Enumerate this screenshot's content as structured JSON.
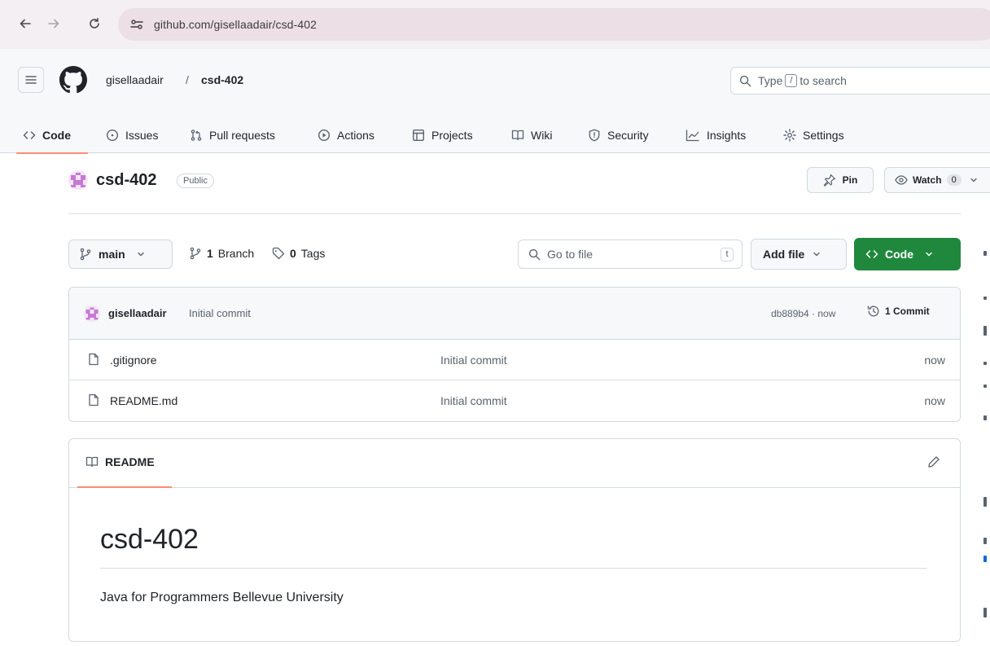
{
  "browser": {
    "url": "github.com/gisellaadair/csd-402"
  },
  "header": {
    "owner": "gisellaadair",
    "separator": "/",
    "repo": "csd-402",
    "search_prefix": "Type",
    "search_key": "/",
    "search_suffix": "to search"
  },
  "tabs": [
    {
      "label": "Code",
      "icon": "code-icon",
      "selected": true
    },
    {
      "label": "Issues",
      "icon": "issue-icon"
    },
    {
      "label": "Pull requests",
      "icon": "pull-request-icon"
    },
    {
      "label": "Actions",
      "icon": "play-icon"
    },
    {
      "label": "Projects",
      "icon": "table-icon"
    },
    {
      "label": "Wiki",
      "icon": "book-icon"
    },
    {
      "label": "Security",
      "icon": "shield-icon"
    },
    {
      "label": "Insights",
      "icon": "graph-icon"
    },
    {
      "label": "Settings",
      "icon": "gear-icon"
    }
  ],
  "repo": {
    "name": "csd-402",
    "visibility": "Public",
    "pin_label": "Pin",
    "watch_label": "Watch",
    "watch_count": "0"
  },
  "file_nav": {
    "branch": "main",
    "branch_count": "1",
    "branch_label": "Branch",
    "tag_count": "0",
    "tag_label": "Tags",
    "goto_placeholder": "Go to file",
    "goto_key": "t",
    "add_file_label": "Add file",
    "code_label": "Code"
  },
  "latest_commit": {
    "author": "gisellaadair",
    "message": "Initial commit",
    "hash_time": "db889b4 · now",
    "commits_label": "1 Commit"
  },
  "files": [
    {
      "name": ".gitignore",
      "message": "Initial commit",
      "date": "now"
    },
    {
      "name": "README.md",
      "message": "Initial commit",
      "date": "now"
    }
  ],
  "readme": {
    "tab_label": "README",
    "heading": "csd-402",
    "body": "Java for Programmers Bellevue University"
  },
  "colors": {
    "accent_underline": "#fd8c73",
    "code_button": "#1f883d"
  }
}
